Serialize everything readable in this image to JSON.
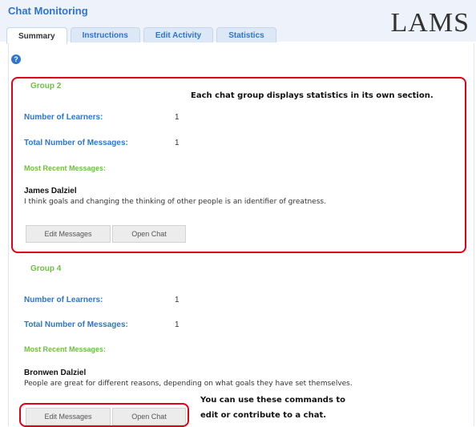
{
  "app": {
    "title": "Chat Monitoring",
    "logo": "LAMS"
  },
  "tabs": [
    {
      "label": "Summary",
      "active": true
    },
    {
      "label": "Instructions",
      "active": false
    },
    {
      "label": "Edit Activity",
      "active": false
    },
    {
      "label": "Statistics",
      "active": false
    }
  ],
  "help_icon": "help-icon",
  "groups": [
    {
      "title": "Group 2",
      "learners_label": "Number of Learners:",
      "learners_value": "1",
      "messages_label": "Total Number of Messages:",
      "messages_value": "1",
      "recent_label": "Most Recent Messages:",
      "author": "James Dalziel",
      "message": "I think goals and changing the thinking of other people is an identifier of greatness.",
      "edit_button": "Edit Messages",
      "open_button": "Open Chat"
    },
    {
      "title": "Group 4",
      "learners_label": "Number of Learners:",
      "learners_value": "1",
      "messages_label": "Total Number of Messages:",
      "messages_value": "1",
      "recent_label": "Most Recent Messages:",
      "author": "Bronwen Dalziel",
      "message": "People are great for different reasons, depending on what goals they have set themselves.",
      "edit_button": "Edit Messages",
      "open_button": "Open Chat"
    }
  ],
  "annotations": {
    "group_note": "Each chat group displays statistics in its own section.",
    "commands_line1": "You can use these commands to",
    "commands_line2": "edit or contribute to a chat."
  },
  "colors": {
    "accent": "#2f75c8",
    "green": "#6fbd44",
    "callout": "#e0001a"
  }
}
